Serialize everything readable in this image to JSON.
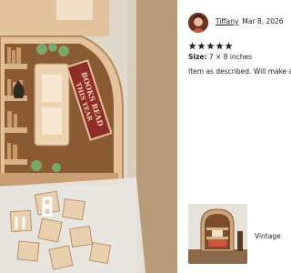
{
  "review": {
    "reviewer_name": "Tiffany",
    "date": "Mar 8, 2026",
    "rating": 5,
    "size_label": "Size:",
    "size_value": "7 × 8 inches",
    "text": "Item as described. Will make a g"
  },
  "product_photo": {
    "sign_text_line1": "BOOKS READ",
    "sign_text_line2": "THIS YEAR"
  },
  "item_thumbnail": {
    "caption": "Vintage"
  },
  "colors": {
    "star": "#222222",
    "wood_light": "#e3c19a",
    "wood_dark": "#8a5a32"
  }
}
